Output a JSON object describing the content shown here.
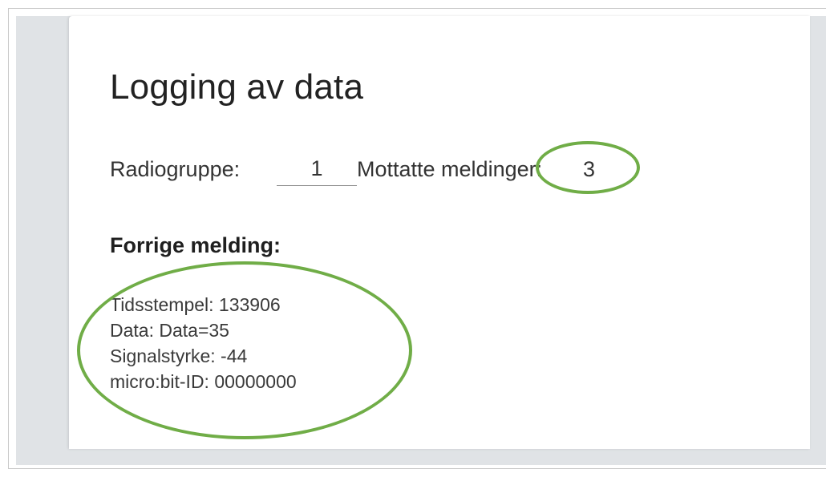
{
  "page": {
    "title": "Logging av data"
  },
  "radio": {
    "group_label": "Radiogruppe:",
    "group_value": "1",
    "received_label": "Mottatte meldinger:",
    "received_count": "3"
  },
  "previous_message": {
    "heading": "Forrige melding:",
    "lines": [
      "Tidsstempel: 133906",
      "Data: Data=35",
      "Signalstyrke: -44",
      "micro:bit-ID: 00000000"
    ]
  },
  "annotations": {
    "color": "#70ad47"
  }
}
